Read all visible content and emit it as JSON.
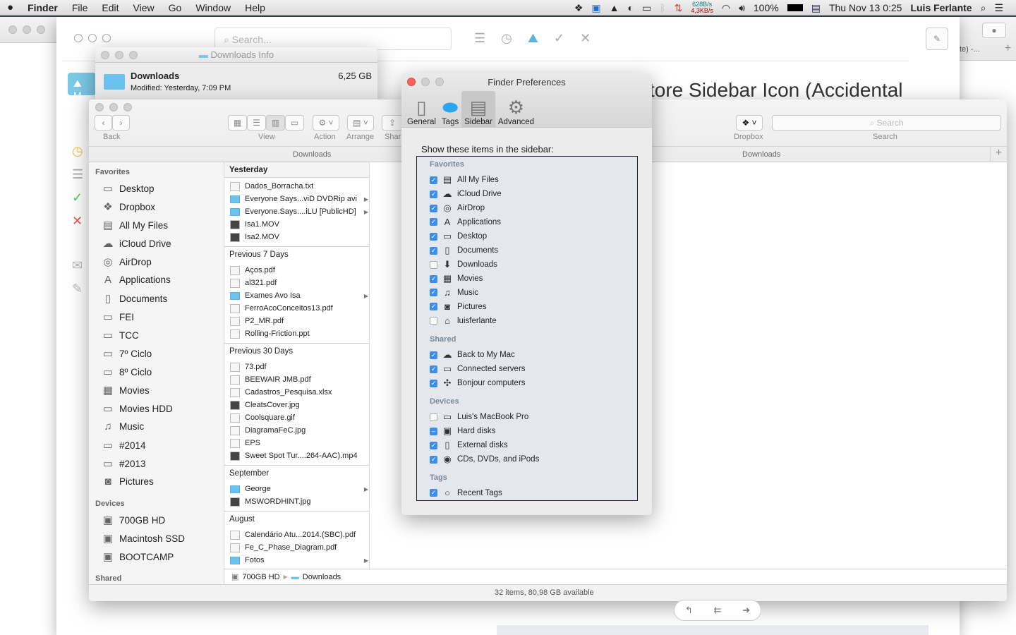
{
  "menubar": {
    "apple": "",
    "app": "Finder",
    "menus": [
      "File",
      "Edit",
      "View",
      "Go",
      "Window",
      "Help"
    ],
    "net_up": "628B/s",
    "net_down": "4,3KB/s",
    "battery": "100%",
    "clock": "Thu Nov 13  0:25",
    "user": "Luis Ferlante"
  },
  "mail_app": {
    "search_placeholder": "Search...",
    "subject": "tore Sidebar Icon (Accidental",
    "mailbox_label": "M"
  },
  "browser": {
    "tab_text": "te) -..."
  },
  "info_window": {
    "title": "Downloads Info",
    "name": "Downloads",
    "size": "6,25 GB",
    "modified": "Modified: Yesterday, 7:09 PM"
  },
  "finder": {
    "toolbar": {
      "back": "Back",
      "view": "View",
      "action": "Action",
      "arrange": "Arrange",
      "share": "Shar",
      "dropbox": "Dropbox",
      "search": "Search",
      "search_placeholder": "Search"
    },
    "path_title": "Downloads",
    "path_title_right": "Downloads",
    "sidebar": {
      "favorites_label": "Favorites",
      "favorites": [
        {
          "label": "Desktop",
          "icon": "desktop-icon",
          "glyph": "▭"
        },
        {
          "label": "Dropbox",
          "icon": "dropbox-icon",
          "glyph": "❖"
        },
        {
          "label": "All My Files",
          "icon": "all-files-icon",
          "glyph": "▤"
        },
        {
          "label": "iCloud Drive",
          "icon": "cloud-icon",
          "glyph": "☁"
        },
        {
          "label": "AirDrop",
          "icon": "airdrop-icon",
          "glyph": "◎"
        },
        {
          "label": "Applications",
          "icon": "applications-icon",
          "glyph": "A"
        },
        {
          "label": "Documents",
          "icon": "documents-icon",
          "glyph": "▯"
        },
        {
          "label": "FEI",
          "icon": "folder-icon",
          "glyph": "▭"
        },
        {
          "label": "TCC",
          "icon": "folder-icon",
          "glyph": "▭"
        },
        {
          "label": "7º Ciclo",
          "icon": "folder-icon",
          "glyph": "▭"
        },
        {
          "label": "8º Ciclo",
          "icon": "folder-icon",
          "glyph": "▭"
        },
        {
          "label": "Movies",
          "icon": "movies-icon",
          "glyph": "▦"
        },
        {
          "label": "Movies HDD",
          "icon": "folder-icon",
          "glyph": "▭"
        },
        {
          "label": "Music",
          "icon": "music-icon",
          "glyph": "♫"
        },
        {
          "label": "#2014",
          "icon": "folder-icon",
          "glyph": "▭"
        },
        {
          "label": "#2013",
          "icon": "folder-icon",
          "glyph": "▭"
        },
        {
          "label": "Pictures",
          "icon": "camera-icon",
          "glyph": "◙"
        }
      ],
      "devices_label": "Devices",
      "devices": [
        {
          "label": "700GB HD",
          "icon": "disk-icon",
          "glyph": "▣"
        },
        {
          "label": "Macintosh SSD",
          "icon": "disk-icon",
          "glyph": "▣"
        },
        {
          "label": "BOOTCAMP",
          "icon": "disk-icon",
          "glyph": "▣"
        }
      ],
      "shared_label": "Shared"
    },
    "groups": [
      {
        "title": "Yesterday",
        "items": [
          {
            "name": "Dados_Borracha.txt",
            "kind": "doc"
          },
          {
            "name": "Everyone Says...viD DVDRip avi",
            "kind": "folder"
          },
          {
            "name": "Everyone.Says....iLU [PublicHD]",
            "kind": "folder"
          },
          {
            "name": "Isa1.MOV",
            "kind": "img"
          },
          {
            "name": "Isa2.MOV",
            "kind": "img"
          }
        ]
      },
      {
        "title": "Previous 7 Days",
        "items": [
          {
            "name": "Aços.pdf",
            "kind": "doc"
          },
          {
            "name": "al321.pdf",
            "kind": "doc"
          },
          {
            "name": "Exames Avo Isa",
            "kind": "folder"
          },
          {
            "name": "FerroAcoConceitos13.pdf",
            "kind": "doc"
          },
          {
            "name": "P2_MR.pdf",
            "kind": "doc"
          },
          {
            "name": "Rolling-Friction.ppt",
            "kind": "doc"
          }
        ]
      },
      {
        "title": "Previous 30 Days",
        "items": [
          {
            "name": "73.pdf",
            "kind": "doc"
          },
          {
            "name": "BEEWAIR JMB.pdf",
            "kind": "doc"
          },
          {
            "name": "Cadastros_Pesquisa.xlsx",
            "kind": "doc"
          },
          {
            "name": "CleatsCover.jpg",
            "kind": "img"
          },
          {
            "name": "Coolsquare.gif",
            "kind": "doc"
          },
          {
            "name": "DiagramaFeC.jpg",
            "kind": "doc"
          },
          {
            "name": "EPS",
            "kind": "doc"
          },
          {
            "name": "Sweet Spot Tur....264-AAC).mp4",
            "kind": "img"
          }
        ]
      },
      {
        "title": "September",
        "items": [
          {
            "name": "George",
            "kind": "folder"
          },
          {
            "name": "MSWORDHINT.jpg",
            "kind": "img"
          }
        ]
      },
      {
        "title": "August",
        "items": [
          {
            "name": "Calendário Atu...2014.(SBC).pdf",
            "kind": "doc"
          },
          {
            "name": "Fe_C_Phase_Diagram.pdf",
            "kind": "doc"
          },
          {
            "name": "Fotos",
            "kind": "folder"
          }
        ]
      }
    ],
    "pathbar": {
      "disk": "700GB HD",
      "folder": "Downloads"
    },
    "status": "32 items, 80,98 GB available"
  },
  "prefs": {
    "title": "Finder Preferences",
    "tabs": [
      {
        "label": "General",
        "icon": "general-icon"
      },
      {
        "label": "Tags",
        "icon": "tag-icon"
      },
      {
        "label": "Sidebar",
        "icon": "sidebar-icon",
        "active": true
      },
      {
        "label": "Advanced",
        "icon": "gear-icon"
      }
    ],
    "heading": "Show these items in the sidebar:",
    "sections": [
      {
        "title": "Favorites",
        "items": [
          {
            "label": "All My Files",
            "state": "on",
            "glyph": "▤"
          },
          {
            "label": "iCloud Drive",
            "state": "on",
            "glyph": "☁"
          },
          {
            "label": "AirDrop",
            "state": "on",
            "glyph": "◎"
          },
          {
            "label": "Applications",
            "state": "on",
            "glyph": "A"
          },
          {
            "label": "Desktop",
            "state": "on",
            "glyph": "▭"
          },
          {
            "label": "Documents",
            "state": "on",
            "glyph": "▯"
          },
          {
            "label": "Downloads",
            "state": "off",
            "glyph": "⬇"
          },
          {
            "label": "Movies",
            "state": "on",
            "glyph": "▦"
          },
          {
            "label": "Music",
            "state": "on",
            "glyph": "♫"
          },
          {
            "label": "Pictures",
            "state": "on",
            "glyph": "◙"
          },
          {
            "label": "luisferlante",
            "state": "off",
            "glyph": "⌂"
          }
        ]
      },
      {
        "title": "Shared",
        "items": [
          {
            "label": "Back to My Mac",
            "state": "on",
            "glyph": "☁"
          },
          {
            "label": "Connected servers",
            "state": "on",
            "glyph": "▭"
          },
          {
            "label": "Bonjour computers",
            "state": "on",
            "glyph": "✣"
          }
        ]
      },
      {
        "title": "Devices",
        "items": [
          {
            "label": "Luis's MacBook Pro",
            "state": "off",
            "glyph": "▭"
          },
          {
            "label": "Hard disks",
            "state": "mixed",
            "glyph": "▣"
          },
          {
            "label": "External disks",
            "state": "on",
            "glyph": "▯"
          },
          {
            "label": "CDs, DVDs, and iPods",
            "state": "on",
            "glyph": "◉"
          }
        ]
      },
      {
        "title": "Tags",
        "items": [
          {
            "label": "Recent Tags",
            "state": "on",
            "glyph": "○"
          }
        ]
      }
    ]
  },
  "colors": {
    "accent": "#3b8ef0",
    "folder": "#6cc3f0",
    "close": "#fc605c"
  }
}
